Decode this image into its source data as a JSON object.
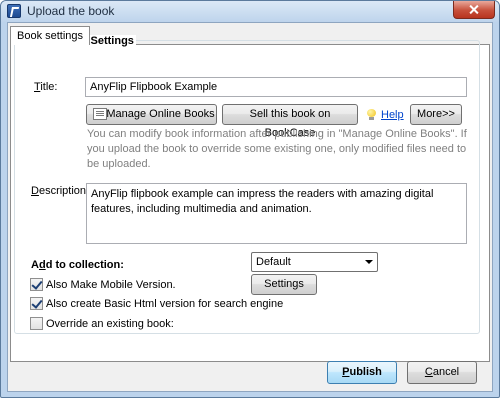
{
  "window": {
    "title": "Upload the book"
  },
  "tabs": [
    {
      "label": "Book settings"
    }
  ],
  "meta": {
    "legend": "HTML Meta Settings",
    "title_label_key": "T",
    "title_label_rest": "itle:",
    "title_value": "AnyFlip Flipbook Example",
    "manage_btn": "Manage Online Books",
    "sell_btn": "Sell this book on BookCase",
    "help_link": "Help",
    "more_btn": "More>>",
    "info_text": "You can modify book information after publishing in \"Manage Online Books\". If you upload the book to override some existing one, only modified files need to be uploaded.",
    "desc_label_key": "D",
    "desc_label_rest": "escription:",
    "desc_value": "AnyFlip flipbook example can impress the readers with amazing digital features, including multimedia and animation."
  },
  "collection": {
    "label_pre": "A",
    "label_key": "d",
    "label_rest": "d to collection:",
    "selected": "Default"
  },
  "options": {
    "mobile": {
      "label": "Also Make Mobile Version.",
      "checked": true
    },
    "settings_btn": "Settings",
    "basic_html": {
      "label": "Also create Basic Html version for search engine",
      "checked": true
    },
    "override": {
      "label": "Override an existing book:",
      "checked": false
    }
  },
  "footer": {
    "publish_key": "P",
    "publish_rest": "ublish",
    "cancel_key": "C",
    "cancel_rest": "ancel"
  }
}
